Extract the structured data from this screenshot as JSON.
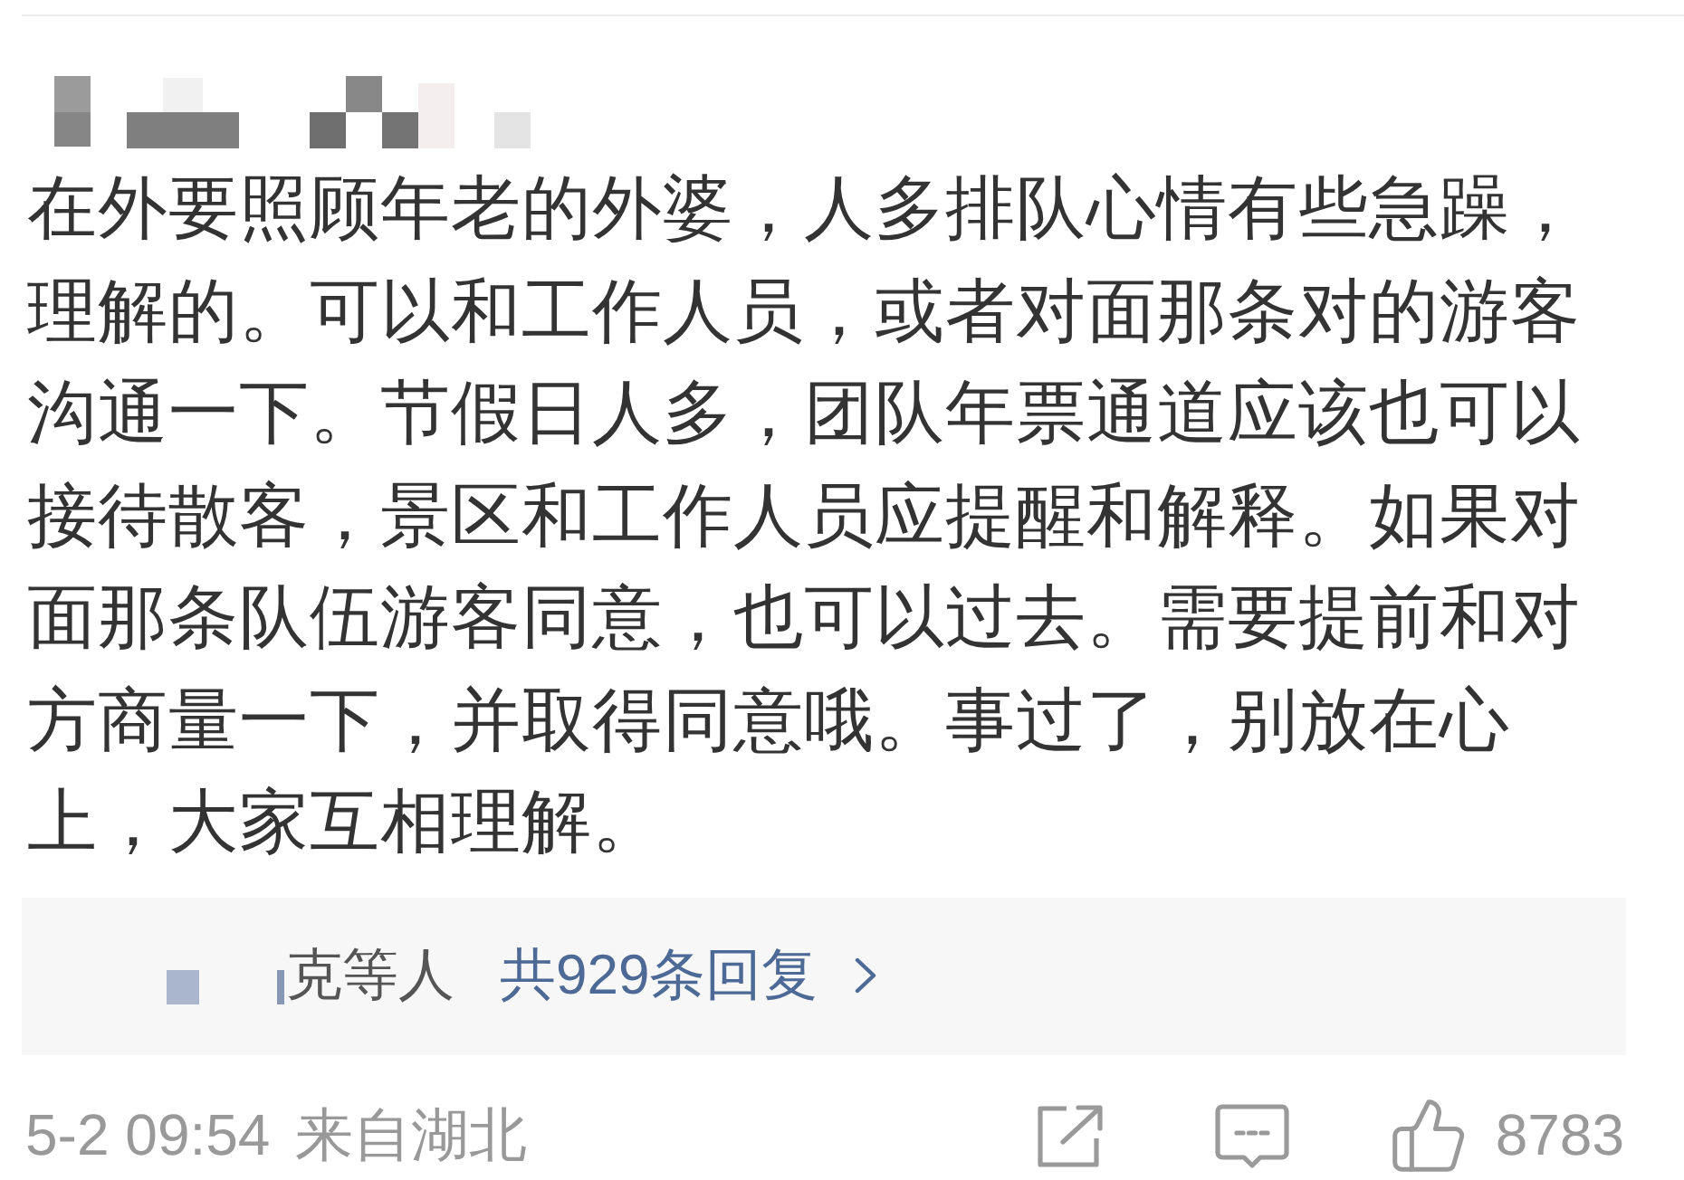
{
  "comment": {
    "text": "在外要照顾年老的外婆，人多排队心情有些急躁，理解的。可以和工作人员，或者对面那条对的游客沟通一下。节假日人多，团队年票通道应该也可以接待散客，景区和工作人员应提醒和解释。如果对面那条队伍游客同意，也可以过去。需要提前和对方商量一下，并取得同意哦。事过了，别放在心上，大家互相理解。",
    "replies": {
      "names": "克等人",
      "link": "共929条回复"
    },
    "footer": {
      "time": "5-2 09:54",
      "location": "来自湖北",
      "likes": "8783"
    }
  }
}
